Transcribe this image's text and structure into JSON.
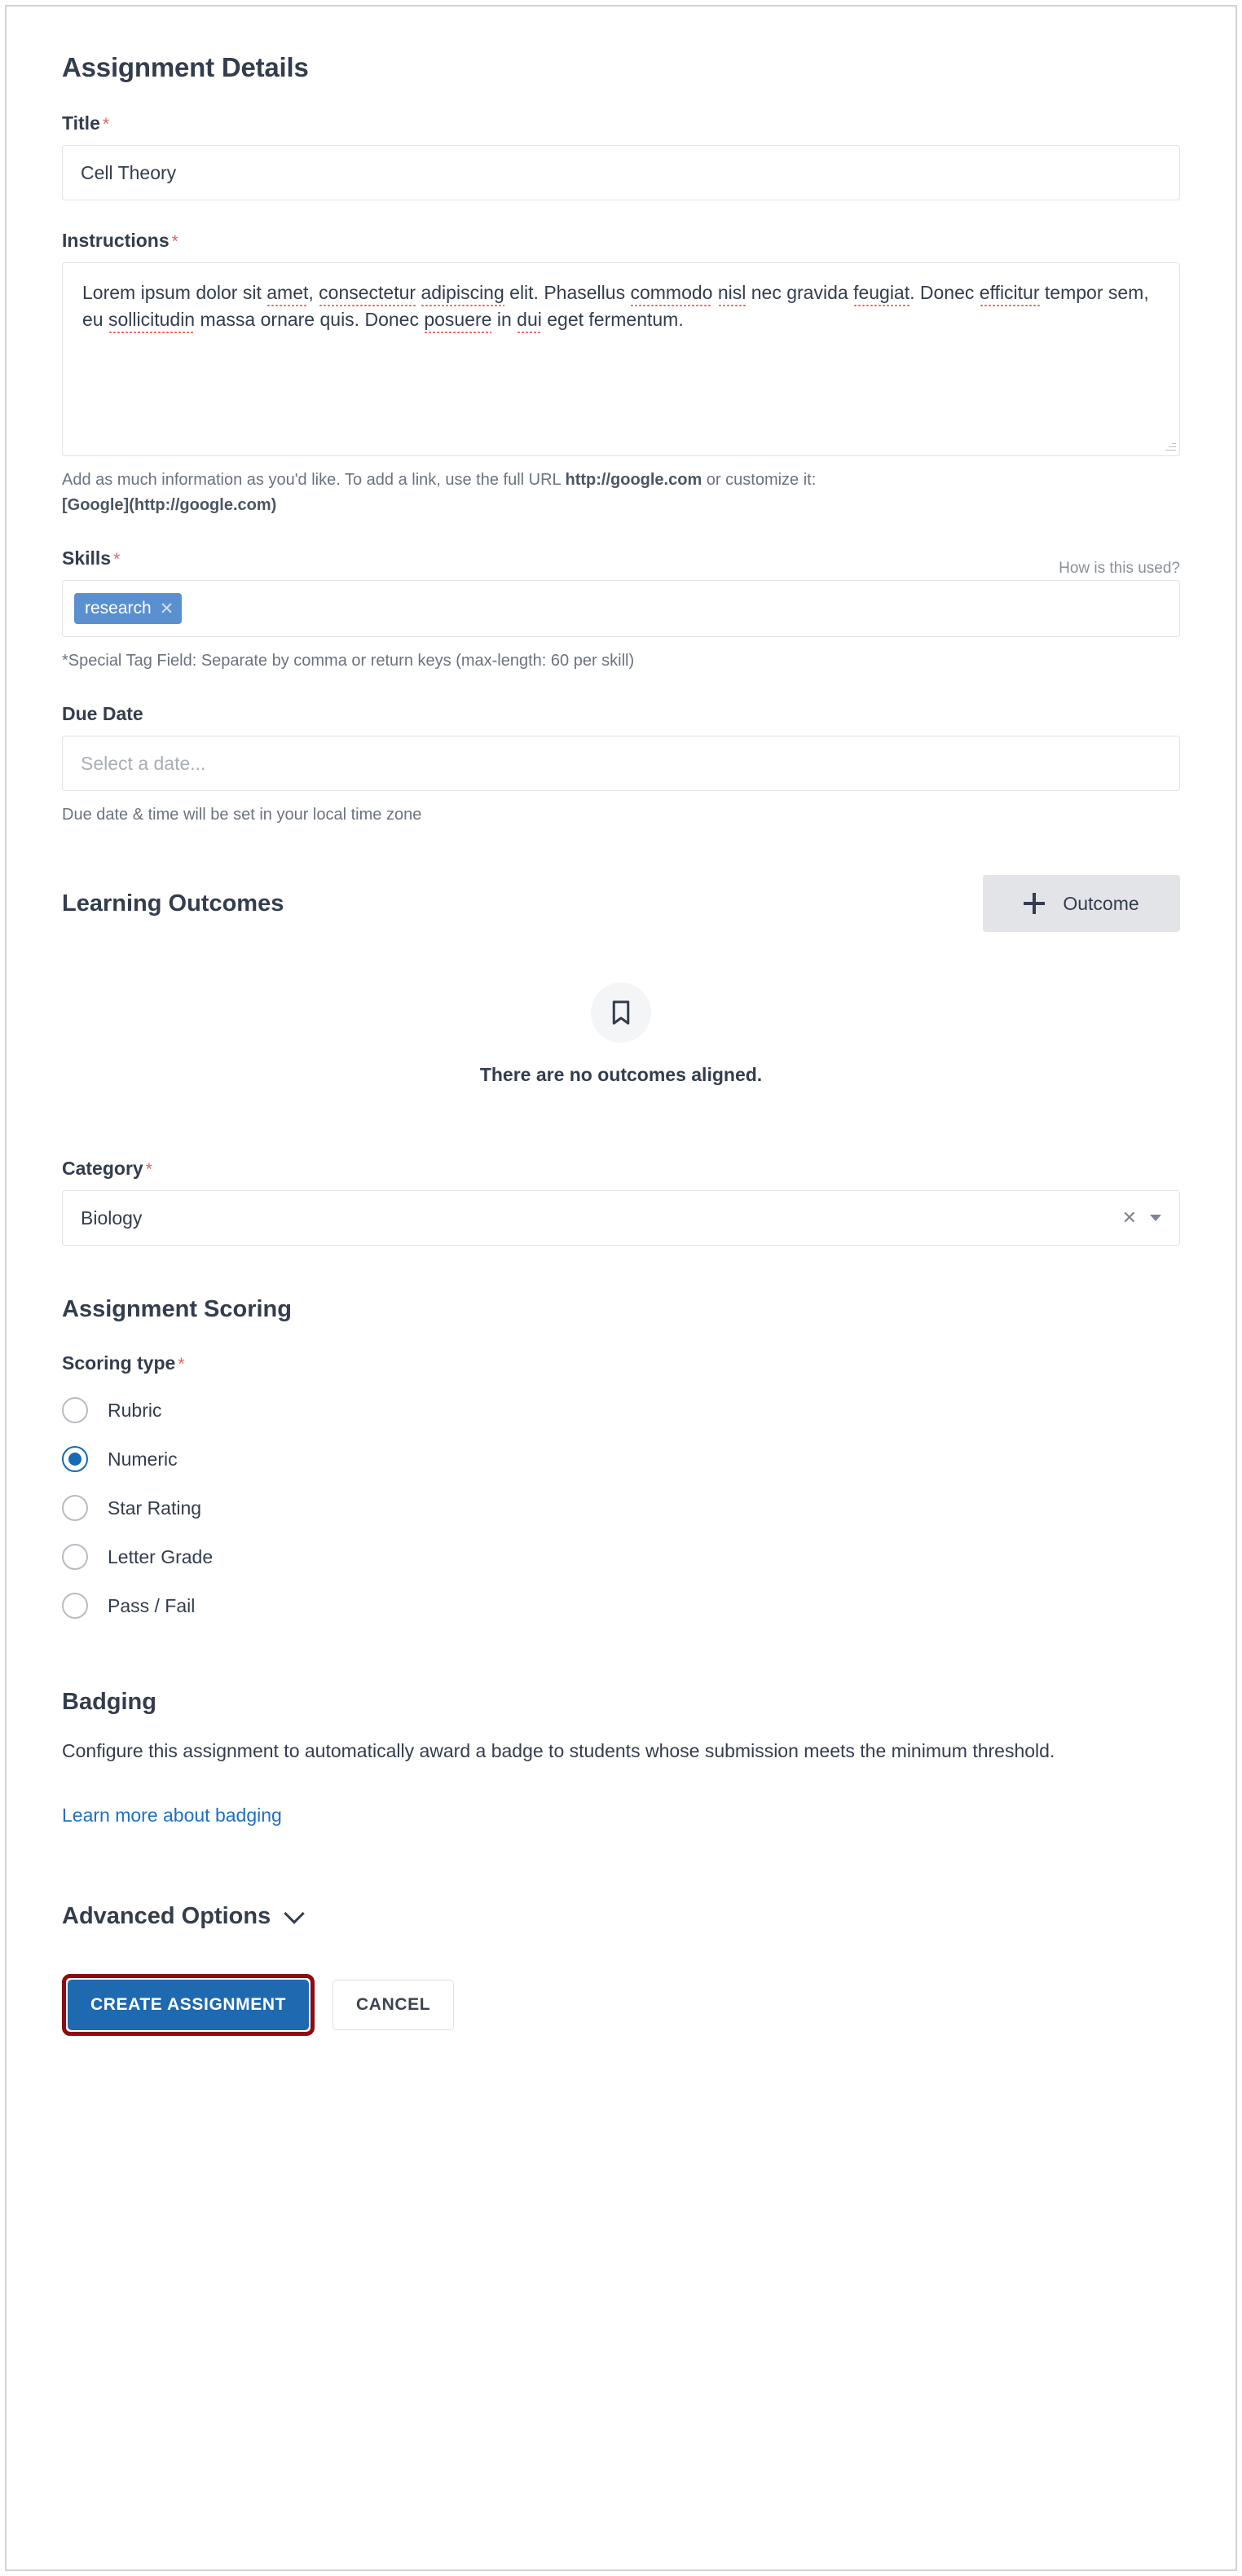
{
  "details": {
    "heading": "Assignment Details",
    "title_label": "Title",
    "title_value": "Cell Theory",
    "instructions_label": "Instructions",
    "instructions_text_parts": [
      {
        "t": "Lorem ipsum dolor sit ",
        "s": false
      },
      {
        "t": "amet",
        "s": true
      },
      {
        "t": ", ",
        "s": false
      },
      {
        "t": "consectetur",
        "s": true
      },
      {
        "t": " ",
        "s": false
      },
      {
        "t": "adipiscing",
        "s": true
      },
      {
        "t": " elit. Phasellus ",
        "s": false
      },
      {
        "t": "commodo",
        "s": true
      },
      {
        "t": " ",
        "s": false
      },
      {
        "t": "nisl",
        "s": true
      },
      {
        "t": " nec gravida ",
        "s": false
      },
      {
        "t": "feugiat",
        "s": true
      },
      {
        "t": ". Donec ",
        "s": false
      },
      {
        "t": "efficitur",
        "s": true
      },
      {
        "t": " tempor sem, eu ",
        "s": false
      },
      {
        "t": "sollicitudin",
        "s": true
      },
      {
        "t": " massa ornare quis. Donec ",
        "s": false
      },
      {
        "t": "posuere",
        "s": true
      },
      {
        "t": " in ",
        "s": false
      },
      {
        "t": "dui",
        "s": true
      },
      {
        "t": " eget fermentum.",
        "s": false
      }
    ],
    "instructions_help_1": "Add as much information as you'd like. To add a link, use the full URL ",
    "instructions_help_url": "http://google.com",
    "instructions_help_2": " or customize it:",
    "instructions_help_3": "[Google](http://google.com)",
    "skills_label": "Skills",
    "skills_how_link": "How is this used?",
    "skills_tags": [
      "research"
    ],
    "skills_help": "*Special Tag Field: Separate by comma or return keys (max-length: 60 per skill)",
    "due_date_label": "Due Date",
    "due_date_placeholder": "Select a date...",
    "due_date_help": "Due date & time will be set in your local time zone",
    "required_mark": "*"
  },
  "outcomes": {
    "heading": "Learning Outcomes",
    "add_button_label": "Outcome",
    "add_button_icon": "plus-icon",
    "empty_icon": "bookmark-icon",
    "empty_message": "There are no outcomes aligned."
  },
  "category": {
    "label": "Category",
    "value": "Biology",
    "clear_icon": "close-icon",
    "caret_icon": "chevron-down-icon"
  },
  "scoring": {
    "heading": "Assignment Scoring",
    "type_label": "Scoring type",
    "options": [
      {
        "label": "Rubric",
        "selected": false
      },
      {
        "label": "Numeric",
        "selected": true
      },
      {
        "label": "Star Rating",
        "selected": false
      },
      {
        "label": "Letter Grade",
        "selected": false
      },
      {
        "label": "Pass / Fail",
        "selected": false
      }
    ]
  },
  "badging": {
    "heading": "Badging",
    "description": "Configure this assignment to automatically award a badge to students whose submission meets the minimum threshold.",
    "link_label": "Learn more about badging"
  },
  "advanced": {
    "label": "Advanced Options",
    "caret_icon": "chevron-down-icon"
  },
  "footer": {
    "primary_label": "CREATE ASSIGNMENT",
    "secondary_label": "CANCEL"
  },
  "colors": {
    "primary_button": "#1e69b0",
    "highlight_outline": "#8c0c12",
    "tag": "#5a8fd0",
    "required": "#e2655b",
    "link": "#1f6fc0",
    "radio_selected": "#1669b5"
  }
}
